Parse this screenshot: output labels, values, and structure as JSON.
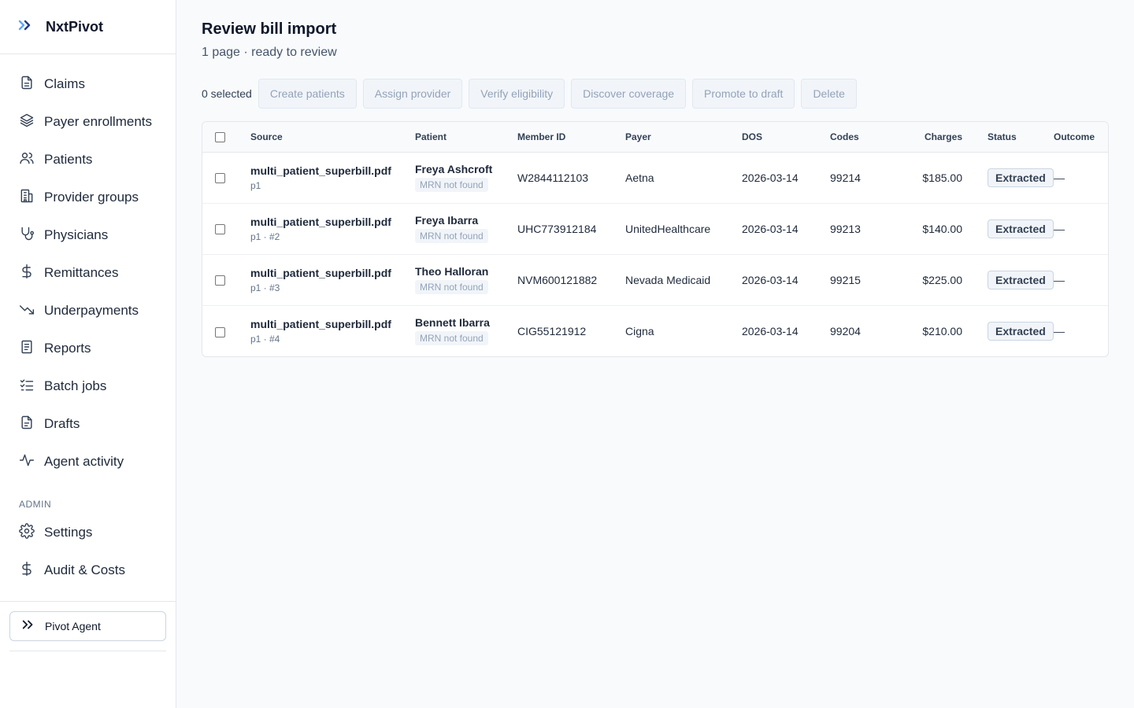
{
  "brand": {
    "name": "NxtPivot"
  },
  "sidebar": {
    "items": [
      {
        "label": "Claims",
        "icon": "document-icon"
      },
      {
        "label": "Payer enrollments",
        "icon": "layers-icon"
      },
      {
        "label": "Patients",
        "icon": "users-icon"
      },
      {
        "label": "Provider groups",
        "icon": "building-icon"
      },
      {
        "label": "Physicians",
        "icon": "stethoscope-icon"
      },
      {
        "label": "Remittances",
        "icon": "dollar-icon"
      },
      {
        "label": "Underpayments",
        "icon": "trending-down-icon"
      },
      {
        "label": "Reports",
        "icon": "report-icon"
      },
      {
        "label": "Batch jobs",
        "icon": "list-checks-icon"
      },
      {
        "label": "Drafts",
        "icon": "file-text-icon"
      },
      {
        "label": "Agent activity",
        "icon": "activity-icon"
      }
    ],
    "admin_label": "ADMIN",
    "admin_items": [
      {
        "label": "Settings",
        "icon": "gear-icon"
      },
      {
        "label": "Audit & Costs",
        "icon": "dollar-icon"
      }
    ],
    "agent_button": "Pivot Agent"
  },
  "page": {
    "title": "Review bill import",
    "subtitle": "1 page · ready to review"
  },
  "toolbar": {
    "selected": "0 selected",
    "buttons": [
      "Create patients",
      "Assign provider",
      "Verify eligibility",
      "Discover coverage",
      "Promote to draft",
      "Delete"
    ]
  },
  "table": {
    "headers": [
      "Source",
      "Patient",
      "Member ID",
      "Payer",
      "DOS",
      "Codes",
      "Charges",
      "Status",
      "Outcome"
    ],
    "rows": [
      {
        "file": "multi_patient_superbill.pdf",
        "page": "p1",
        "patient": "Freya Ashcroft",
        "mrn": "MRN not found",
        "member_id": "W2844112103",
        "payer": "Aetna",
        "dos": "2026-03-14",
        "codes": "99214",
        "charges": "$185.00",
        "status": "Extracted",
        "outcome": "—"
      },
      {
        "file": "multi_patient_superbill.pdf",
        "page": "p1 · #2",
        "patient": "Freya Ibarra",
        "mrn": "MRN not found",
        "member_id": "UHC773912184",
        "payer": "UnitedHealthcare",
        "dos": "2026-03-14",
        "codes": "99213",
        "charges": "$140.00",
        "status": "Extracted",
        "outcome": "—"
      },
      {
        "file": "multi_patient_superbill.pdf",
        "page": "p1 · #3",
        "patient": "Theo Halloran",
        "mrn": "MRN not found",
        "member_id": "NVM600121882",
        "payer": "Nevada Medicaid",
        "dos": "2026-03-14",
        "codes": "99215",
        "charges": "$225.00",
        "status": "Extracted",
        "outcome": "—"
      },
      {
        "file": "multi_patient_superbill.pdf",
        "page": "p1 · #4",
        "patient": "Bennett Ibarra",
        "mrn": "MRN not found",
        "member_id": "CIG55121912",
        "payer": "Cigna",
        "dos": "2026-03-14",
        "codes": "99204",
        "charges": "$210.00",
        "status": "Extracted",
        "outcome": "—"
      }
    ]
  },
  "colors": {
    "brand_accent": "#1e3a8a",
    "badge_bg": "#f1f5f9",
    "disabled_text": "#94a3b8"
  }
}
